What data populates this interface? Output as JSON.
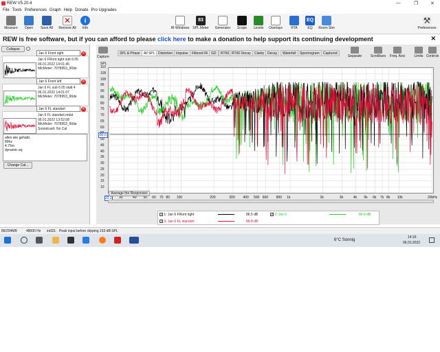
{
  "window": {
    "title": "REW V5.20.4"
  },
  "menu": [
    "File",
    "Tools",
    "Preferences",
    "Graph",
    "Help",
    "Donate",
    "Pro Upgrades"
  ],
  "toolbar": {
    "left": [
      "Measure",
      "Open",
      "Save All",
      "Remove All",
      "Info"
    ],
    "center": [
      "IR Windows",
      "SPL Meter",
      "Generator",
      "Scope",
      "Levels",
      "Overlays",
      "RTA",
      "EQ",
      "Room Sim"
    ],
    "spl_meter_value": "83",
    "spl_meter_unit": "dB SPL",
    "right": "Preferences"
  },
  "banner": {
    "pre": "REW is free software, but if you can afford to please ",
    "link": "click here",
    "post": " to make a donation to help support its continuing development"
  },
  "left_panel": {
    "collapse": "Collapse",
    "measurements": [
      {
        "name": "Jan 6 Front right",
        "line1": "Jan 6 FRont right sub 6.05",
        "line2": "06.01.2022 14:01:45",
        "line3": "MicMeter: 7078953_90de",
        "color": "#000000"
      },
      {
        "name": "Jan 6 Front left",
        "line1": "Jan 6 FL sub 6.05 stalt 4",
        "line2": "06.01.2022 14:01:07",
        "line3": "MicMeter: 7078953_90de",
        "color": "#22cc22"
      },
      {
        "name": "Jan 6 FL standart",
        "line1": "Jan 6 FL standart.mdat",
        "line2": "06.01.2022 13:52:08",
        "line3": "MicMeter: 7078953_90de",
        "line4": "Soundcard: No Cal",
        "color": "#e0103a"
      }
    ],
    "notes": [
      "alles wie gehabt.",
      "80hz",
      "4.75m",
      "dynamic eq"
    ],
    "change_cal": "Change Cal..."
  },
  "graph": {
    "capture": "Capture",
    "tabs": [
      "SPL & Phase",
      "All SPL",
      "Distortion",
      "Impulse",
      "Filtered IR",
      "GD",
      "RT60",
      "RT60 Decay",
      "Clarity",
      "Decay",
      "Waterfall",
      "Spectrogram",
      "Captured"
    ],
    "selected_tab": "All SPL",
    "right_tools": [
      "Separate",
      "Scrollbars",
      "Freq. Axis",
      "Limits",
      "Controls"
    ],
    "y_unit": "SPL",
    "y_ticks": [
      "110",
      "105",
      "100",
      "95",
      "90",
      "85",
      "80",
      "75",
      "70",
      "65",
      "60",
      "55",
      "50",
      "45",
      "40",
      "35",
      "30",
      "25",
      "20",
      "15",
      "10"
    ],
    "y_marker": "80.0",
    "x_ticks": [
      "22.2",
      "30",
      "40",
      "50",
      "60",
      "70",
      "80",
      "100",
      "200",
      "300",
      "400",
      "500",
      "600",
      "800",
      "1k",
      "2k",
      "3k",
      "4k",
      "5k",
      "6k",
      "7k",
      "8k",
      "10k",
      "20kHz"
    ],
    "average_button": "Average the Responses"
  },
  "legend": [
    {
      "label": "1: Jan 6 FRont right",
      "value": "86.5 dB",
      "color": "#000000"
    },
    {
      "label": "2: Jan 6",
      "value": "86.6 dB",
      "color": "#22cc22"
    },
    {
      "label": "3: Jan 6 FL standart",
      "value": "86.8 dB",
      "color": "#e0103a"
    }
  ],
  "status": {
    "memory": "86/204MB",
    "rate": "48000 Hz",
    "format": "int32L",
    "message": "Peak input before clipping 153 dB SPL"
  },
  "taskbar": {
    "weather": "6°C  Sonnig",
    "time": "14:16",
    "date": "06.01.2022"
  }
}
